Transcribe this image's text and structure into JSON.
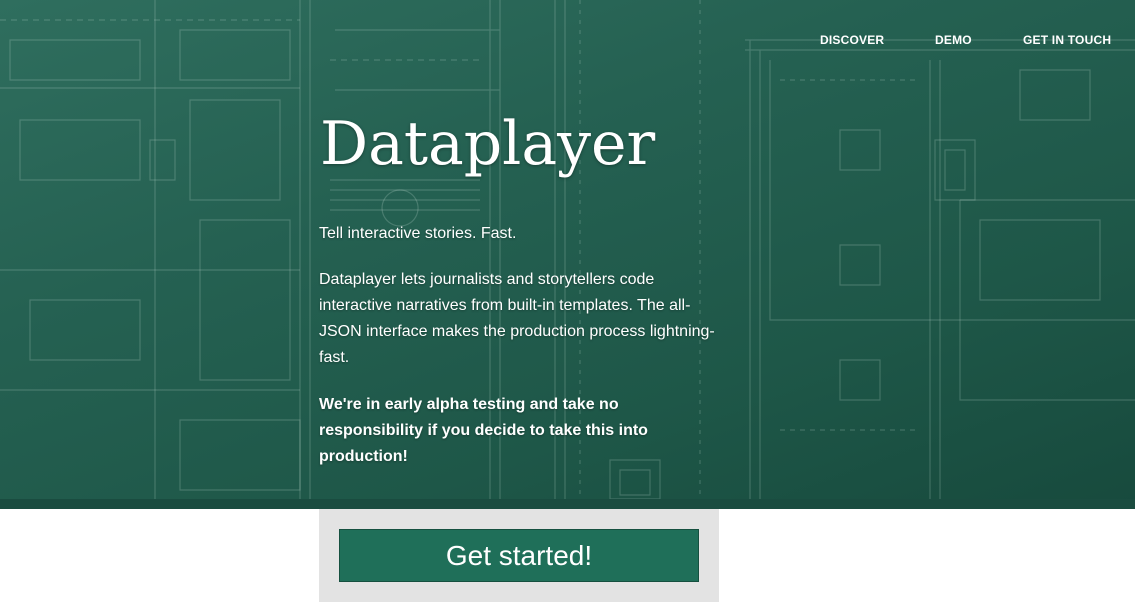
{
  "nav": {
    "items": [
      {
        "label": "DISCOVER"
      },
      {
        "label": "DEMO"
      },
      {
        "label": "GET IN TOUCH"
      }
    ]
  },
  "hero": {
    "title": "Dataplayer",
    "tagline": "Tell interactive stories. Fast.",
    "description": "Dataplayer lets journalists and storytellers code interactive narratives from built-in templates. The all-JSON interface makes the production process lightning-fast.",
    "warning": "We're in early alpha testing and take no responsibility if you decide to take this into production!"
  },
  "cta": {
    "label": "Get started!"
  },
  "colors": {
    "hero_background": "#236050",
    "button_background": "#1f6f59",
    "cta_panel": "#e3e3e3",
    "text": "#ffffff"
  },
  "background_image": "blueprint-floor-plan"
}
